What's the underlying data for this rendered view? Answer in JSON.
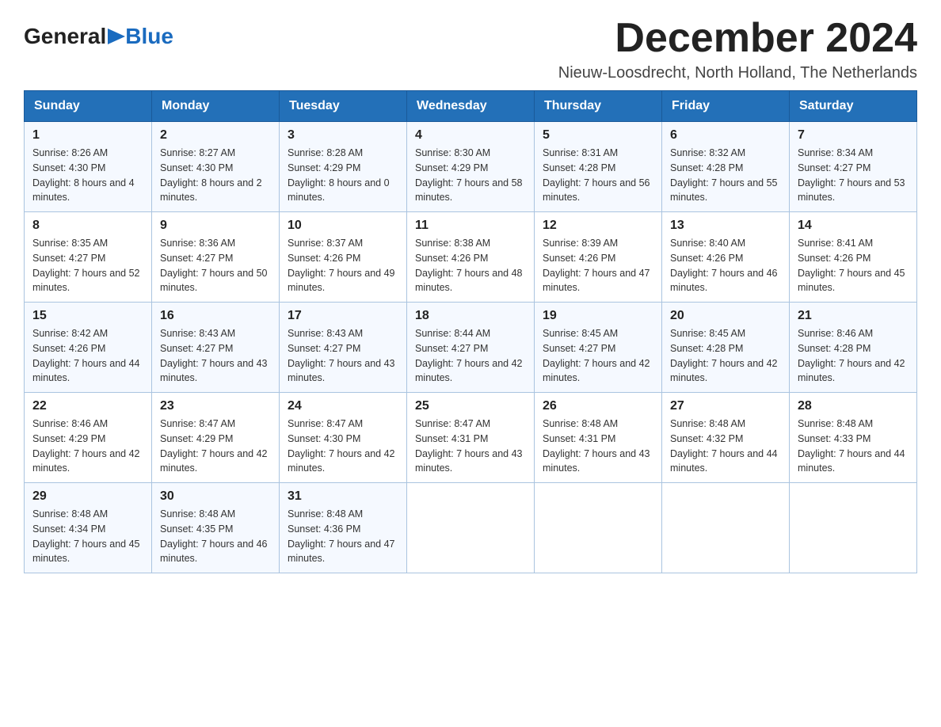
{
  "header": {
    "month_title": "December 2024",
    "location": "Nieuw-Loosdrecht, North Holland, The Netherlands"
  },
  "days_of_week": [
    "Sunday",
    "Monday",
    "Tuesday",
    "Wednesday",
    "Thursday",
    "Friday",
    "Saturday"
  ],
  "weeks": [
    [
      {
        "day": "1",
        "sunrise": "8:26 AM",
        "sunset": "4:30 PM",
        "daylight": "8 hours and 4 minutes."
      },
      {
        "day": "2",
        "sunrise": "8:27 AM",
        "sunset": "4:30 PM",
        "daylight": "8 hours and 2 minutes."
      },
      {
        "day": "3",
        "sunrise": "8:28 AM",
        "sunset": "4:29 PM",
        "daylight": "8 hours and 0 minutes."
      },
      {
        "day": "4",
        "sunrise": "8:30 AM",
        "sunset": "4:29 PM",
        "daylight": "7 hours and 58 minutes."
      },
      {
        "day": "5",
        "sunrise": "8:31 AM",
        "sunset": "4:28 PM",
        "daylight": "7 hours and 56 minutes."
      },
      {
        "day": "6",
        "sunrise": "8:32 AM",
        "sunset": "4:28 PM",
        "daylight": "7 hours and 55 minutes."
      },
      {
        "day": "7",
        "sunrise": "8:34 AM",
        "sunset": "4:27 PM",
        "daylight": "7 hours and 53 minutes."
      }
    ],
    [
      {
        "day": "8",
        "sunrise": "8:35 AM",
        "sunset": "4:27 PM",
        "daylight": "7 hours and 52 minutes."
      },
      {
        "day": "9",
        "sunrise": "8:36 AM",
        "sunset": "4:27 PM",
        "daylight": "7 hours and 50 minutes."
      },
      {
        "day": "10",
        "sunrise": "8:37 AM",
        "sunset": "4:26 PM",
        "daylight": "7 hours and 49 minutes."
      },
      {
        "day": "11",
        "sunrise": "8:38 AM",
        "sunset": "4:26 PM",
        "daylight": "7 hours and 48 minutes."
      },
      {
        "day": "12",
        "sunrise": "8:39 AM",
        "sunset": "4:26 PM",
        "daylight": "7 hours and 47 minutes."
      },
      {
        "day": "13",
        "sunrise": "8:40 AM",
        "sunset": "4:26 PM",
        "daylight": "7 hours and 46 minutes."
      },
      {
        "day": "14",
        "sunrise": "8:41 AM",
        "sunset": "4:26 PM",
        "daylight": "7 hours and 45 minutes."
      }
    ],
    [
      {
        "day": "15",
        "sunrise": "8:42 AM",
        "sunset": "4:26 PM",
        "daylight": "7 hours and 44 minutes."
      },
      {
        "day": "16",
        "sunrise": "8:43 AM",
        "sunset": "4:27 PM",
        "daylight": "7 hours and 43 minutes."
      },
      {
        "day": "17",
        "sunrise": "8:43 AM",
        "sunset": "4:27 PM",
        "daylight": "7 hours and 43 minutes."
      },
      {
        "day": "18",
        "sunrise": "8:44 AM",
        "sunset": "4:27 PM",
        "daylight": "7 hours and 42 minutes."
      },
      {
        "day": "19",
        "sunrise": "8:45 AM",
        "sunset": "4:27 PM",
        "daylight": "7 hours and 42 minutes."
      },
      {
        "day": "20",
        "sunrise": "8:45 AM",
        "sunset": "4:28 PM",
        "daylight": "7 hours and 42 minutes."
      },
      {
        "day": "21",
        "sunrise": "8:46 AM",
        "sunset": "4:28 PM",
        "daylight": "7 hours and 42 minutes."
      }
    ],
    [
      {
        "day": "22",
        "sunrise": "8:46 AM",
        "sunset": "4:29 PM",
        "daylight": "7 hours and 42 minutes."
      },
      {
        "day": "23",
        "sunrise": "8:47 AM",
        "sunset": "4:29 PM",
        "daylight": "7 hours and 42 minutes."
      },
      {
        "day": "24",
        "sunrise": "8:47 AM",
        "sunset": "4:30 PM",
        "daylight": "7 hours and 42 minutes."
      },
      {
        "day": "25",
        "sunrise": "8:47 AM",
        "sunset": "4:31 PM",
        "daylight": "7 hours and 43 minutes."
      },
      {
        "day": "26",
        "sunrise": "8:48 AM",
        "sunset": "4:31 PM",
        "daylight": "7 hours and 43 minutes."
      },
      {
        "day": "27",
        "sunrise": "8:48 AM",
        "sunset": "4:32 PM",
        "daylight": "7 hours and 44 minutes."
      },
      {
        "day": "28",
        "sunrise": "8:48 AM",
        "sunset": "4:33 PM",
        "daylight": "7 hours and 44 minutes."
      }
    ],
    [
      {
        "day": "29",
        "sunrise": "8:48 AM",
        "sunset": "4:34 PM",
        "daylight": "7 hours and 45 minutes."
      },
      {
        "day": "30",
        "sunrise": "8:48 AM",
        "sunset": "4:35 PM",
        "daylight": "7 hours and 46 minutes."
      },
      {
        "day": "31",
        "sunrise": "8:48 AM",
        "sunset": "4:36 PM",
        "daylight": "7 hours and 47 minutes."
      },
      null,
      null,
      null,
      null
    ]
  ]
}
